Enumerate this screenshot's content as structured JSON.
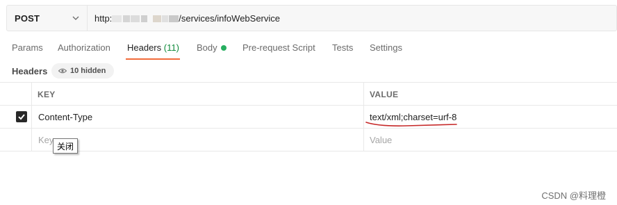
{
  "request": {
    "method": "POST",
    "url_prefix": "http:",
    "url_suffix": "/services/infoWebService"
  },
  "tabs": [
    {
      "label": "Params"
    },
    {
      "label": "Authorization"
    },
    {
      "label": "Headers",
      "count": "(11)",
      "active": true
    },
    {
      "label": "Body"
    },
    {
      "label": "Pre-request Script"
    },
    {
      "label": "Tests"
    },
    {
      "label": "Settings"
    }
  ],
  "headers_section": {
    "title": "Headers",
    "hidden_label": "10 hidden"
  },
  "table": {
    "columns": [
      "KEY",
      "VALUE"
    ],
    "rows": [
      {
        "checked": true,
        "key": "Content-Type",
        "value": "text/xml;charset=urf-8"
      }
    ],
    "placeholder": {
      "key": "Key",
      "value": "Value"
    }
  },
  "tooltip": "关闭",
  "watermark": "CSDN @料理橙",
  "colors": {
    "accent": "#f26b3a",
    "count_green": "#0e8a3a",
    "body_dot": "#27ae60",
    "annotation_red": "#c62828"
  }
}
